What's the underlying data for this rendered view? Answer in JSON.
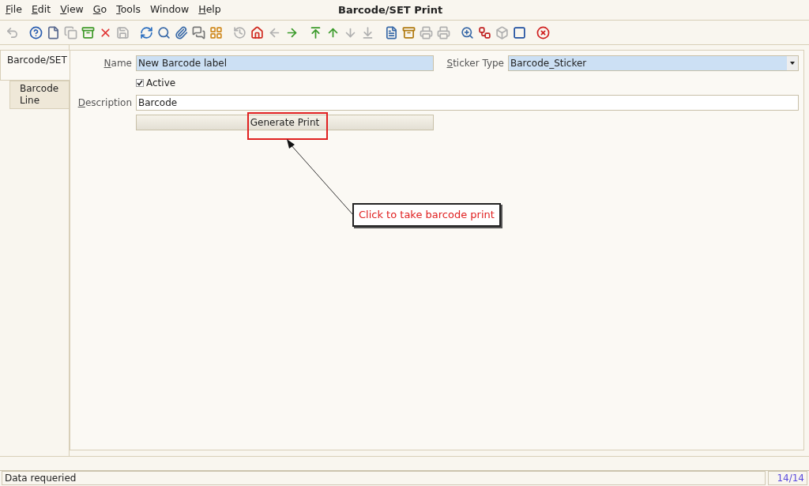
{
  "menu": [
    {
      "label": "File",
      "mnemonic": true
    },
    {
      "label": "Edit",
      "mnemonic": true
    },
    {
      "label": "View",
      "mnemonic": true
    },
    {
      "label": "Go",
      "mnemonic": true
    },
    {
      "label": "Tools",
      "mnemonic": true
    },
    {
      "label": "Window",
      "mnemonic": false
    },
    {
      "label": "Help",
      "mnemonic": true
    }
  ],
  "window": {
    "title": "Barcode/SET Print"
  },
  "toolbar": [
    {
      "kind": "undo",
      "disabled": true
    },
    {
      "kind": "help",
      "disabled": false
    },
    {
      "kind": "new",
      "disabled": false
    },
    {
      "kind": "copy",
      "disabled": true
    },
    {
      "kind": "bin",
      "disabled": false
    },
    {
      "kind": "delete",
      "disabled": false
    },
    {
      "kind": "save",
      "disabled": true
    },
    {
      "kind": "refresh",
      "disabled": false
    },
    {
      "kind": "search",
      "disabled": false
    },
    {
      "kind": "attach",
      "disabled": false
    },
    {
      "kind": "chat",
      "disabled": false
    },
    {
      "kind": "grid",
      "disabled": false
    },
    {
      "kind": "history",
      "disabled": true
    },
    {
      "kind": "home",
      "disabled": false
    },
    {
      "kind": "left",
      "disabled": true
    },
    {
      "kind": "right",
      "disabled": false
    },
    {
      "kind": "first",
      "disabled": false
    },
    {
      "kind": "up",
      "disabled": false
    },
    {
      "kind": "down",
      "disabled": true
    },
    {
      "kind": "last",
      "disabled": true
    },
    {
      "kind": "report",
      "disabled": false
    },
    {
      "kind": "archive",
      "disabled": false
    },
    {
      "kind": "print",
      "disabled": true
    },
    {
      "kind": "print",
      "disabled": true
    },
    {
      "kind": "zoom",
      "disabled": false
    },
    {
      "kind": "workflow",
      "disabled": false
    },
    {
      "kind": "product",
      "disabled": true
    },
    {
      "kind": "square",
      "disabled": false
    },
    {
      "kind": "close",
      "disabled": false
    }
  ],
  "tabs": [
    {
      "label": "Barcode/SET",
      "selected": true
    },
    {
      "label": "Barcode Line",
      "selected": false
    }
  ],
  "form": {
    "name": {
      "label": "Name",
      "value": "New Barcode label"
    },
    "sticker_type": {
      "label": "Sticker Type",
      "value": "Barcode_Sticker"
    },
    "active": {
      "label": "Active",
      "checked": true
    },
    "description": {
      "label": "Description",
      "value": "Barcode"
    },
    "button": {
      "label": "Generate Print",
      "highlighted": true
    }
  },
  "callout": {
    "text": "Click to take barcode print"
  },
  "status_bar": {
    "message": "Data requeried",
    "count": "14/14"
  }
}
